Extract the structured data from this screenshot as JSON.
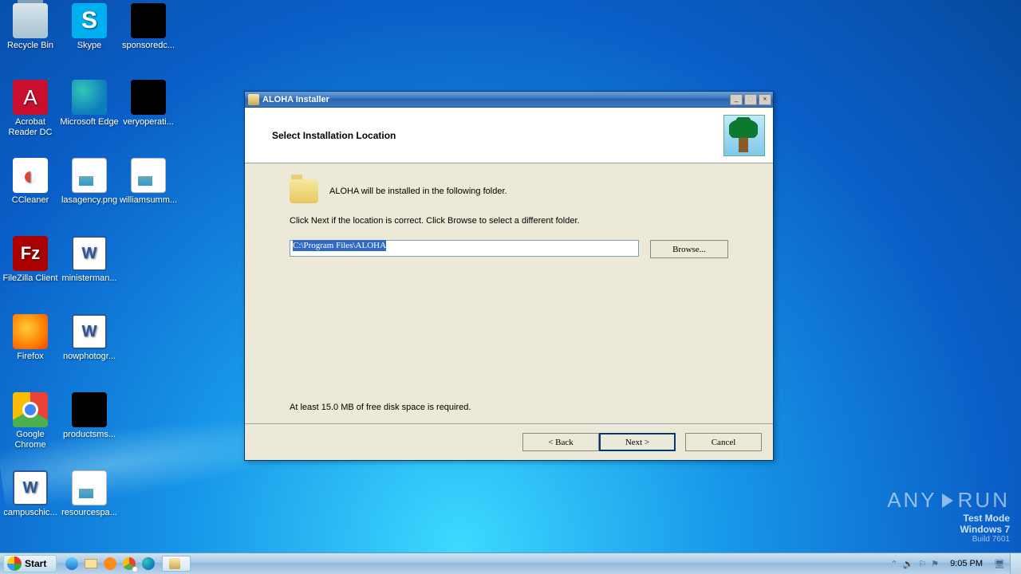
{
  "desktop": {
    "icons": [
      {
        "label": "Recycle Bin"
      },
      {
        "label": "Skype"
      },
      {
        "label": "sponsoredc..."
      },
      {
        "label": "Acrobat Reader DC"
      },
      {
        "label": "Microsoft Edge"
      },
      {
        "label": "veryoperati..."
      },
      {
        "label": "CCleaner"
      },
      {
        "label": "lasagency.png"
      },
      {
        "label": "williamsumm..."
      },
      {
        "label": "FileZilla Client"
      },
      {
        "label": "ministerman..."
      },
      {
        "label": "Firefox"
      },
      {
        "label": "nowphotogr..."
      },
      {
        "label": "Google Chrome"
      },
      {
        "label": "productsms..."
      },
      {
        "label": "campuschic..."
      },
      {
        "label": "resourcespa..."
      }
    ]
  },
  "installer": {
    "title": "ALOHA Installer",
    "heading": "Select Installation Location",
    "line1": "ALOHA will be installed in the following folder.",
    "line2": "Click Next if the location is correct. Click Browse to select a different folder.",
    "path": "C:\\Program Files\\ALOHA",
    "browse": "Browse...",
    "diskspace": "At least 15.0 MB of free disk space is required.",
    "back": "< Back",
    "next": "Next >",
    "cancel": "Cancel"
  },
  "watermark": {
    "brand_a": "ANY",
    "brand_b": "RUN",
    "l2": "Test Mode",
    "l3": "Windows 7",
    "l4": "Build 7601"
  },
  "taskbar": {
    "start": "Start",
    "clock": "9:05 PM"
  }
}
